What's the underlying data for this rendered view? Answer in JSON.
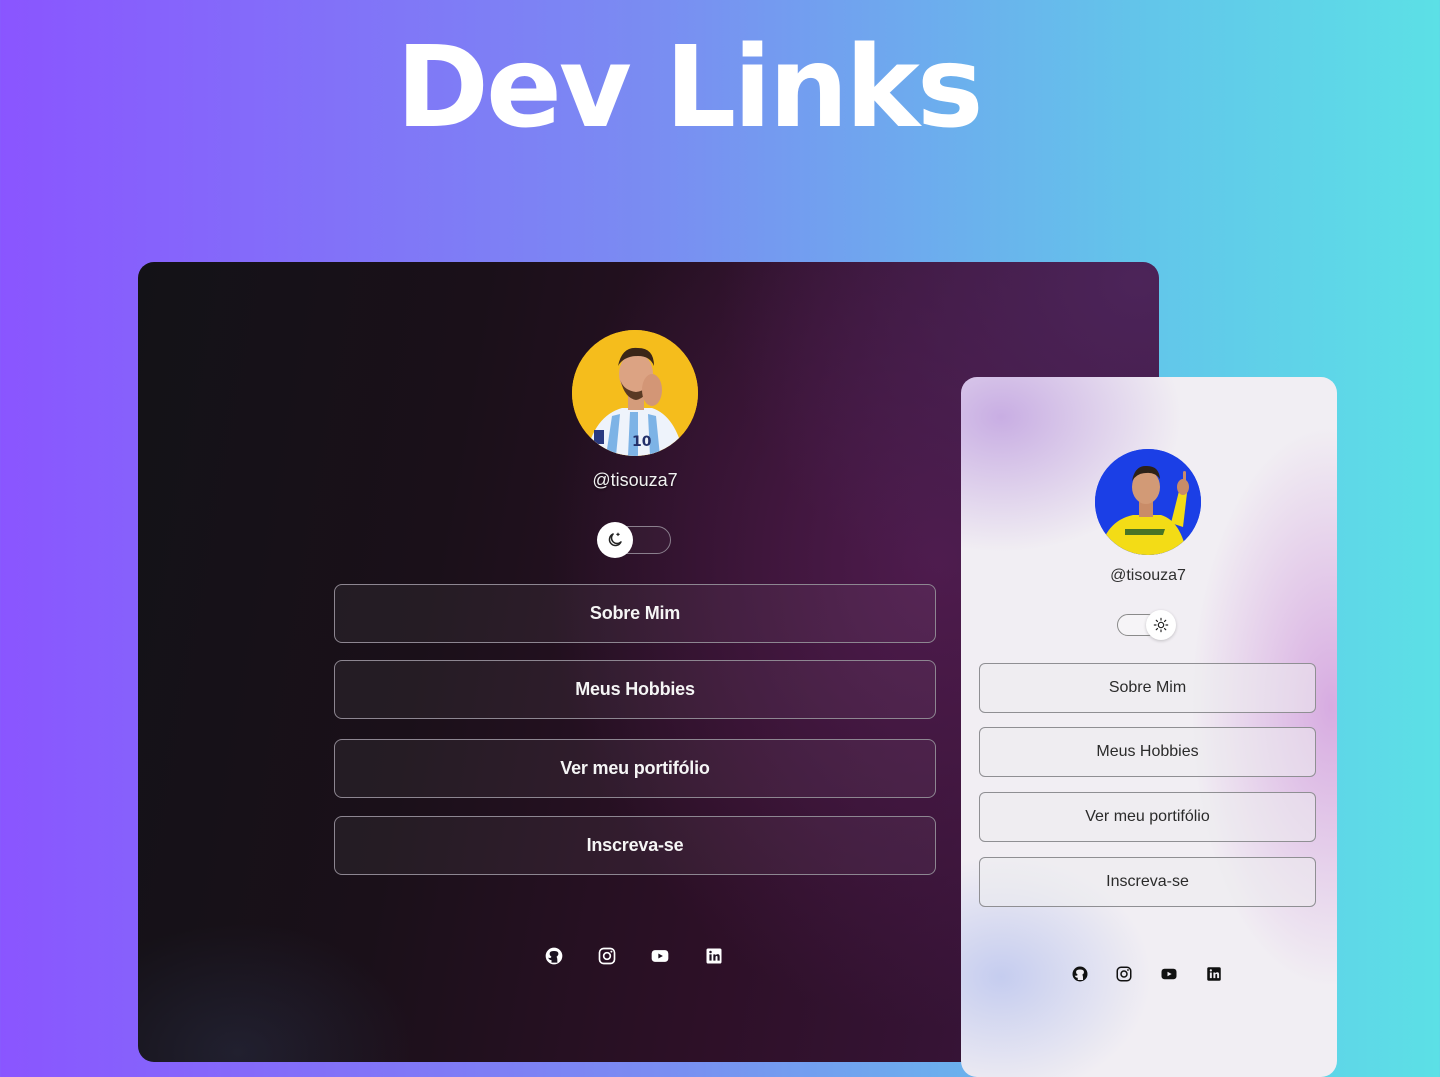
{
  "hero": {
    "title": "Dev Links"
  },
  "dark_card": {
    "theme": "dark",
    "handle": "@tisouza7",
    "toggle_icon": "moon-icon",
    "links": [
      {
        "label": "Sobre Mim"
      },
      {
        "label": "Meus Hobbies"
      },
      {
        "label": "Ver meu portifólio"
      },
      {
        "label": "Inscreva-se"
      }
    ],
    "socials": [
      "github-icon",
      "instagram-icon",
      "youtube-icon",
      "linkedin-icon"
    ],
    "colors": {
      "text": "#f5f5f5",
      "border": "#8d8691",
      "background_end": "#4c2459"
    }
  },
  "light_card": {
    "theme": "light",
    "handle": "@tisouza7",
    "toggle_icon": "sun-icon",
    "links": [
      {
        "label": "Sobre Mim"
      },
      {
        "label": "Meus Hobbies"
      },
      {
        "label": "Ver meu portifólio"
      },
      {
        "label": "Inscreva-se"
      }
    ],
    "socials": [
      "github-icon",
      "instagram-icon",
      "youtube-icon",
      "linkedin-icon"
    ],
    "colors": {
      "text": "#2b2b2b",
      "border": "#8f8f93",
      "accent": "#d6a8e0"
    }
  },
  "colors": {
    "page_gradient_start": "#8a55ff",
    "page_gradient_end": "#5ce0e6"
  }
}
